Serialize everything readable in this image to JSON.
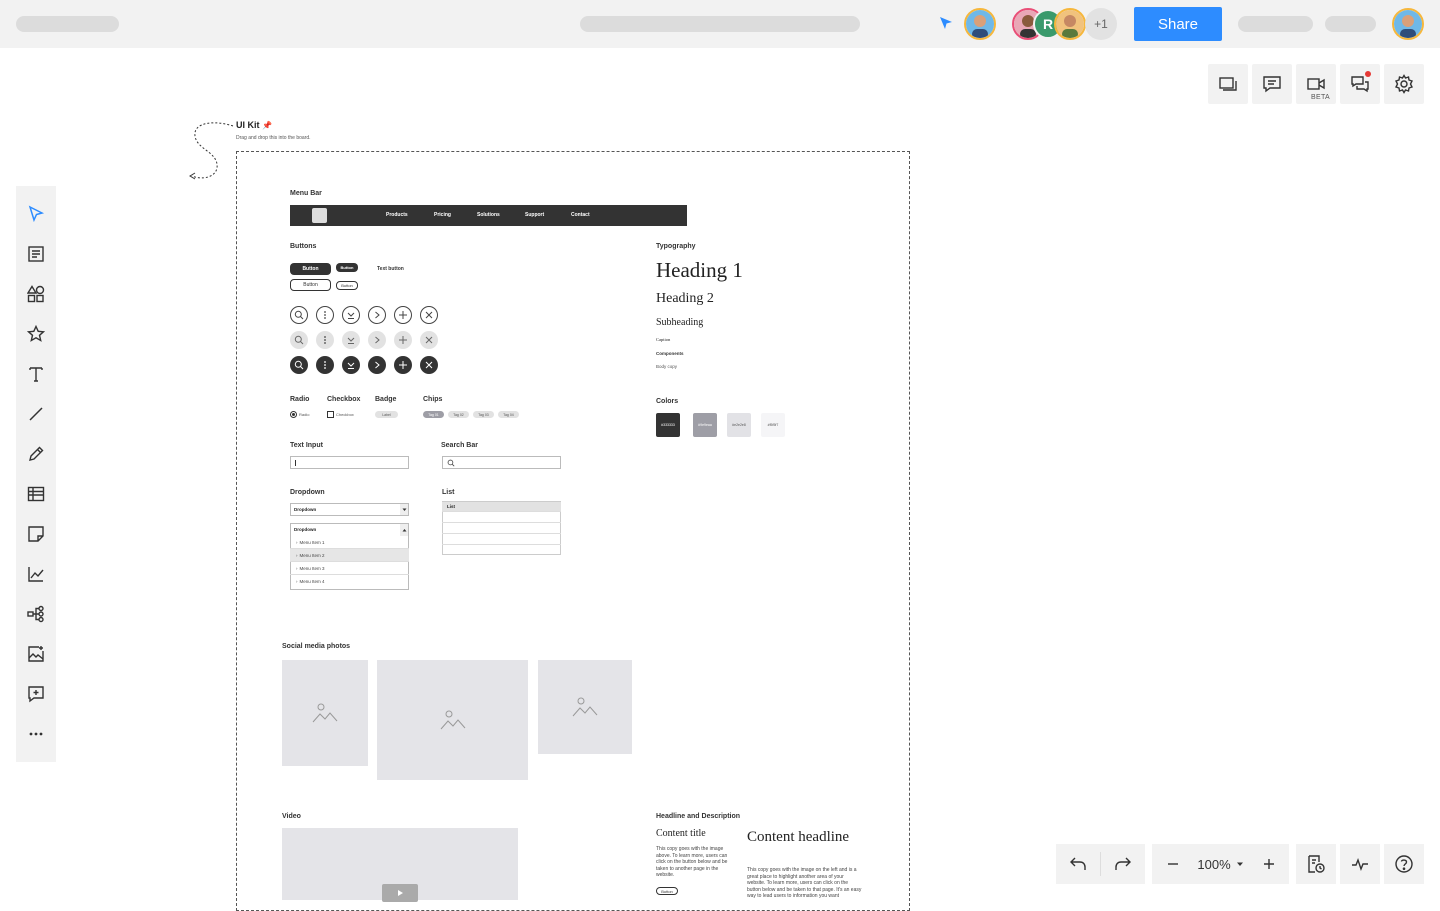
{
  "topbar": {
    "share_label": "Share",
    "collaborator_initial": "R",
    "extra_collaborators": "+1"
  },
  "right_tools": {
    "beta_label": "BETA"
  },
  "bottom_tools": {
    "zoom_level": "100%"
  },
  "canvas": {
    "title": "UI Kit",
    "subtitle": "Drag and drop this into the board."
  },
  "kit": {
    "menu_bar_label": "Menu Bar",
    "menu_items": [
      "Products",
      "Pricing",
      "Solutions",
      "Support",
      "Contact"
    ],
    "buttons_label": "Buttons",
    "button_text": "Button",
    "text_button": "Text button",
    "radio_label": "Radio",
    "checkbox_label": "Checkbox",
    "badge_label": "Badge",
    "badge_value": "Label",
    "chips_label": "Chips",
    "chips": [
      "Tag 01",
      "Tag 02",
      "Tag 03",
      "Tag 04"
    ],
    "text_input_label": "Text Input",
    "search_bar_label": "Search Bar",
    "dropdown_label": "Dropdown",
    "dropdown_value": "Dropdown",
    "dropdown_items": [
      "Menu Item 1",
      "Menu Item 2",
      "Menu Item 3",
      "Menu Item 4"
    ],
    "list_label": "List",
    "list_header": "List",
    "typography_label": "Typography",
    "heading1": "Heading 1",
    "heading2": "Heading 2",
    "subheading": "Subheading",
    "caption": "Caption",
    "components": "Components",
    "body_copy": "Body copy",
    "colors_label": "Colors",
    "colors": [
      {
        "hex": "#333333",
        "label": "#333333"
      },
      {
        "hex": "#9e9ea6",
        "label": "#9e9eaa"
      },
      {
        "hex": "#e2e2e6",
        "label": "#e2e2e8"
      },
      {
        "hex": "#f5f5f7",
        "label": "#f5f5f7"
      }
    ],
    "social_label": "Social media photos",
    "video_label": "Video",
    "headline_desc_label": "Headline and Description",
    "content_title": "Content title",
    "content_title_body": "This copy goes with the image above. To learn more, users can click on the button below and be taken to another page in the website.",
    "content_button": "Button",
    "content_headline": "Content headline",
    "content_headline_body": "This copy goes with the image on the left and is a great place to highlight another area of your website. To learn more, users can click on the button below and be taken to that page. It's an easy way to lead users to information you want"
  }
}
